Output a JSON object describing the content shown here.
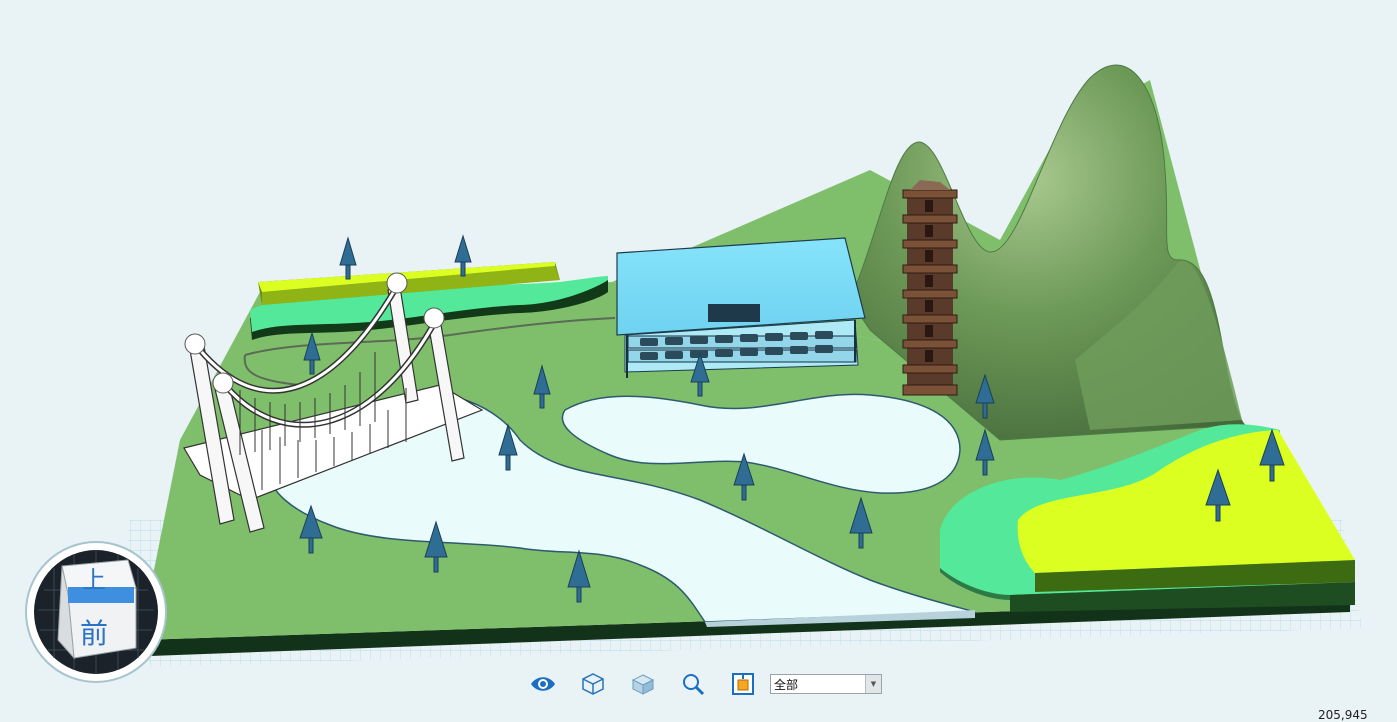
{
  "scene": {
    "background": "#e9f2f5",
    "ground_color": "#7fbf6c",
    "water_color": "#e9fbfb",
    "hill_color": "#6e9a58",
    "roof_color": "#7ddcf6",
    "field_yellow": "#dcff22",
    "field_green": "#54e89a",
    "tree_color": "#2f6d94",
    "pagoda_color": "#5a3a2a"
  },
  "nav_cube": {
    "top_face": "上",
    "front_face": "前"
  },
  "toolbar": {
    "buttons": [
      {
        "name": "visibility-eye-icon"
      },
      {
        "name": "cube-wireframe-icon"
      },
      {
        "name": "cube-shaded-icon"
      },
      {
        "name": "zoom-magnifier-icon"
      },
      {
        "name": "fit-view-icon"
      }
    ],
    "view_select_value": "全部"
  },
  "coordinates": "205,945"
}
